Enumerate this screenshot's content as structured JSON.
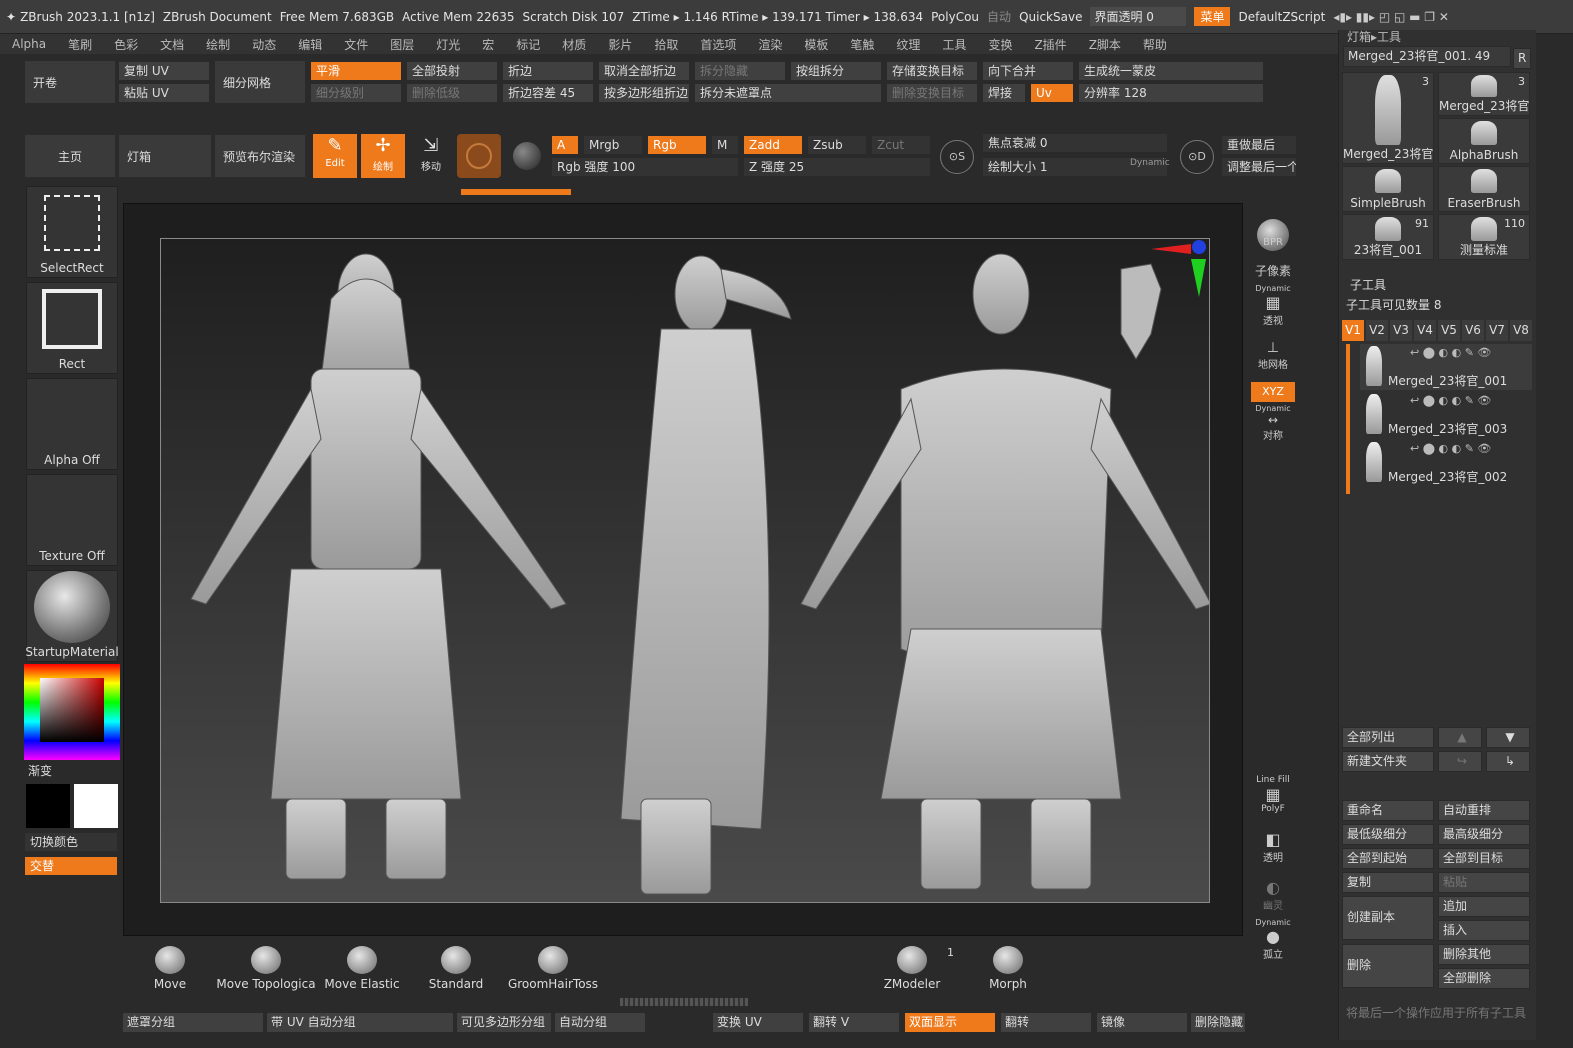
{
  "titlebar": {
    "app": "ZBrush 2023.1.1 [n1z]",
    "doc": "ZBrush Document",
    "free_mem": "Free Mem 7.683GB",
    "active_mem": "Active Mem 22635",
    "scratch": "Scratch Disk 107",
    "ztime": "ZTime ▸ 1.146 RTime ▸ 139.171 Timer ▸ 138.634",
    "polycount": "PolyCou",
    "auto": "自动",
    "quicksave": "QuickSave",
    "ui_transparency": "界面透明 0",
    "menu": "菜单",
    "script": "DefaultZScript"
  },
  "menubar": [
    "Alpha",
    "笔刷",
    "色彩",
    "文档",
    "绘制",
    "动态",
    "编辑",
    "文件",
    "图层",
    "灯光",
    "宏",
    "标记",
    "材质",
    "影片",
    "拾取",
    "首选项",
    "渲染",
    "模板",
    "笔触",
    "纹理",
    "工具",
    "变换",
    "Z插件",
    "Z脚本",
    "帮助"
  ],
  "toolbar1": {
    "kaijuan": "开卷",
    "copy_uv": "复制 UV",
    "paste_uv": "粘贴 UV",
    "subdiv_mesh": "细分网格",
    "smooth": "平滑",
    "subdiv_level": "细分级别",
    "project_all": "全部投射",
    "del_lower": "删除低级",
    "crease": "折边",
    "crease_tol": "折边容差 45",
    "uncrease_all": "取消全部折边",
    "by_polygroup_crease": "按多边形组折边",
    "split_hidden": "拆分隐藏",
    "split_unmasked": "拆分未遮罩点",
    "split_by_group": "按组拆分",
    "store_morph": "存储变换目标",
    "del_morph": "删除变换目标",
    "merge_down": "向下合并",
    "weld": "焊接",
    "uv": "Uv",
    "unified_skin": "生成统一蒙皮",
    "resolution": "分辨率 128"
  },
  "toolbar2": {
    "home": "主页",
    "lightbox": "灯箱",
    "preview_bpr": "预览布尔渲染",
    "edit": "Edit",
    "draw": "绘制",
    "move": "移动",
    "a": "A",
    "mrgb": "Mrgb",
    "rgb": "Rgb",
    "m": "M",
    "rgb_intensity": "Rgb 强度 100",
    "zadd": "Zadd",
    "zsub": "Zsub",
    "zcut": "Zcut",
    "z_intensity": "Z 强度 25",
    "focal_shift": "焦点衰减 0",
    "draw_size": "绘制大小 1",
    "dynamic": "Dynamic",
    "redo_last": "重做最后",
    "adjust_last": "调整最后一个"
  },
  "left_shelf": {
    "select_rect": "SelectRect",
    "rect": "Rect",
    "alpha_off": "Alpha Off",
    "texture_off": "Texture Off",
    "material": "StartupMaterial",
    "gradient": "渐变",
    "switch_color": "切换颜色",
    "alternate": "交替",
    "colors": {
      "accent": "#ee7a1c",
      "bg": "#2a2a2a",
      "canvas": "#1e1e1e"
    }
  },
  "right_rail": {
    "bpr": "BPR",
    "subpixel": "子像素",
    "dynamic1": "Dynamic",
    "perspective": "透视",
    "floor": "地网格",
    "xyz": "XYZ",
    "dynamic2": "Dynamic",
    "symmetry": "对称",
    "linefill": "Line Fill",
    "polyf": "PolyF",
    "transp": "透明",
    "ghost": "幽灵",
    "dynamic3": "Dynamic",
    "solo": "孤立"
  },
  "bottom_brushes": [
    {
      "label": "Move"
    },
    {
      "label": "Move Topologica"
    },
    {
      "label": "Move Elastic"
    },
    {
      "label": "Standard"
    },
    {
      "label": "GroomHairToss"
    },
    {
      "label": "ZModeler",
      "count": "1"
    },
    {
      "label": "Morph"
    }
  ],
  "bottom_bar": {
    "mask_groups": "遮罩分组",
    "uv_auto_groups": "带 UV 自动分组",
    "visible_polygroup": "可见多边形分组",
    "auto_groups": "自动分组",
    "transform_uv": "变换 UV",
    "flip_v": "翻转 V",
    "double_sided": "双面显示",
    "flip": "翻转",
    "mirror": "镜像",
    "del_hidden": "删除隐藏"
  },
  "right_panel": {
    "lightbox_tool": "灯箱▸工具",
    "merged_slider": "Merged_23将官_001. 49",
    "r": "R",
    "tools": [
      {
        "name": "Merged_23将官",
        "count": "3"
      },
      {
        "name": "Merged_23将官",
        "count": "3"
      },
      {
        "name": "AlphaBrush"
      },
      {
        "name": "SimpleBrush"
      },
      {
        "name": "EraserBrush"
      },
      {
        "name": "23将官_001",
        "count": "91"
      },
      {
        "name": "测量标准",
        "count": "110"
      }
    ],
    "subtool_title": "子工具",
    "subtool_count": "子工具可见数量 8",
    "versions": [
      "V1",
      "V2",
      "V3",
      "V4",
      "V5",
      "V6",
      "V7",
      "V8"
    ],
    "subtools": [
      "Merged_23将官_001",
      "Merged_23将官_003",
      "Merged_23将官_002"
    ],
    "list_all": "全部列出",
    "new_folder": "新建文件夹",
    "rename": "重命名",
    "auto_reorder": "自动重排",
    "lowest_subdiv": "最低级细分",
    "highest_subdiv": "最高级细分",
    "all_to_start": "全部到起始",
    "all_to_target": "全部到目标",
    "duplicate": "复制",
    "paste": "粘贴",
    "create_copy": "创建副本",
    "append": "追加",
    "insert": "插入",
    "delete": "删除",
    "delete_other": "删除其他",
    "delete_all": "全部删除",
    "apply_last": "将最后一个操作应用于所有子工具"
  }
}
